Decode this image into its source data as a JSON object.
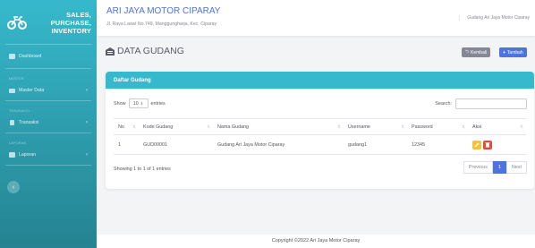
{
  "brand": {
    "line1": "SALES,",
    "line2": "PURCHASE,",
    "line3": "INVENTORY",
    "icon": "motorcycle-icon"
  },
  "sidebar": {
    "dashboard": "Dashboard",
    "heading_master": "MASTER",
    "master_data": "Master Data",
    "heading_transaksi": "TRANSAKSI",
    "transaksi": "Transaksi",
    "heading_laporan": "LAPORAN",
    "laporan": "Laporan",
    "toggle": "‹"
  },
  "topbar": {
    "title": "ARI JAYA MOTOR CIPARAY",
    "subtitle": "Jl. Raya Laswi No.749, Manggungharja, Kec. Ciparay",
    "user": "Gudang Ari Jaya Motor Ciparay"
  },
  "page": {
    "title": "DATA GUDANG",
    "back_label": "Kembali",
    "add_label": "Tambah"
  },
  "card": {
    "title": "Daftar Gudang",
    "show_label": "Show",
    "entries_value": "10",
    "entries_label": "entries",
    "search_label": "Search:",
    "columns": [
      "No",
      "Kode Gudang",
      "Nama Gudang",
      "Username",
      "Password",
      "Aksi"
    ],
    "rows": [
      {
        "no": "1",
        "kode": "GUD00001",
        "nama": "Gudang Ari Jaya Motor Ciparay",
        "username": "gudang1",
        "password": "12345"
      }
    ],
    "info": "Showing 1 to 1 of 1 entries",
    "pager": {
      "previous": "Previous",
      "current": "1",
      "next": "Next"
    }
  },
  "footer": "Copyright ©2022 Ari Jaya Motor Ciparay",
  "colors": {
    "primary": "#4e73df",
    "info": "#36b9cc",
    "warning": "#f6c23e",
    "danger": "#e74a3b",
    "secondary": "#858796"
  }
}
